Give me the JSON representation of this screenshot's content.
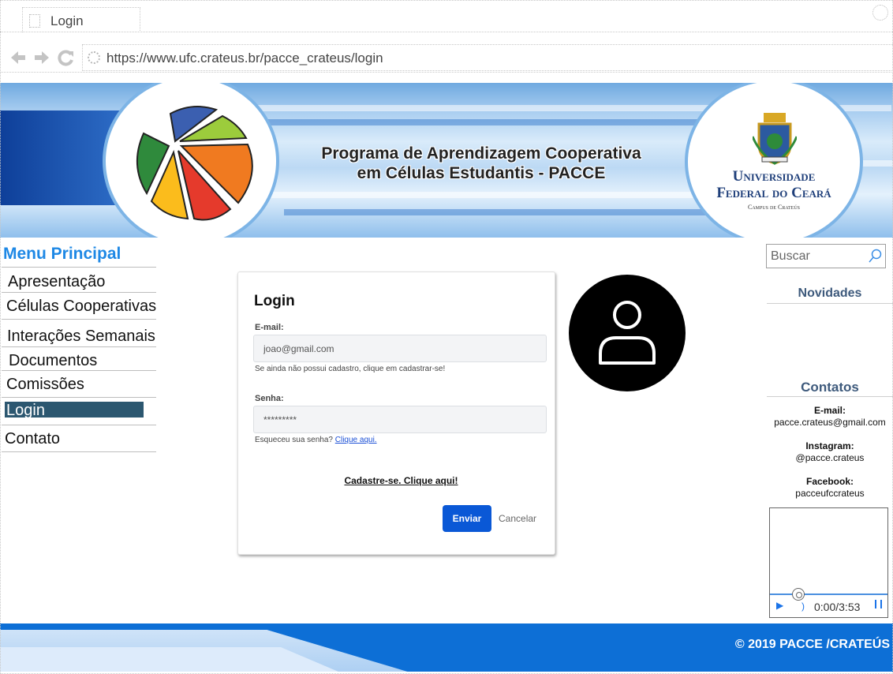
{
  "browser": {
    "tab_title": "Login",
    "url": "https://www.ufc.crateus.br/pacce_crateus/login"
  },
  "banner": {
    "title_line1": "Programa de Aprendizagem Cooperativa",
    "title_line2": "em Células Estudantis - PACCE",
    "university_line1": "Universidade",
    "university_line2": "Federal do Ceará",
    "campus": "Campus de Crateús"
  },
  "menu": {
    "title": "Menu Principal",
    "items": [
      {
        "label": "Apresentação"
      },
      {
        "label": "Células Cooperativas"
      },
      {
        "label": "Interações Semanais"
      },
      {
        "label": "Documentos"
      },
      {
        "label": "Comissões"
      },
      {
        "label": "Login",
        "active": true
      },
      {
        "label": "Contato"
      }
    ]
  },
  "login": {
    "title": "Login",
    "email_label": "E-mail:",
    "email_value": "joao@gmail.com",
    "email_help": "Se ainda não possui cadastro, clique em cadastrar-se!",
    "password_label": "Senha:",
    "password_value": "*********",
    "forgot_text": "Esqueceu sua senha?",
    "forgot_link": "Clique aqui.",
    "register_link": "Cadastre-se. Clique aqui!",
    "submit_label": "Enviar",
    "cancel_label": "Cancelar"
  },
  "sidebar": {
    "search_placeholder": "Buscar",
    "news_heading": "Novidades",
    "contacts_heading": "Contatos",
    "contacts": [
      {
        "label": "E-mail:",
        "value": "pacce.crateus@gmail.com"
      },
      {
        "label": "Instagram:",
        "value": "@pacce.crateus"
      },
      {
        "label": "Facebook:",
        "value": "pacceufccrateus"
      }
    ],
    "video": {
      "time": "0:00/3:53"
    }
  },
  "footer": {
    "copyright": "© 2019 PACCE /CRATEÚS"
  },
  "icons": [
    "back-arrow-icon",
    "forward-arrow-icon",
    "reload-icon",
    "loading-icon",
    "search-icon",
    "user-icon",
    "play-icon",
    "volume-icon",
    "fullscreen-icon"
  ],
  "colors": {
    "menu_title": "#1e88e5",
    "menu_active_bg": "#2c5770",
    "primary_button": "#0a58d6",
    "footer_bg": "#0d6fd6",
    "sidebar_heading": "#3e5a7c"
  }
}
